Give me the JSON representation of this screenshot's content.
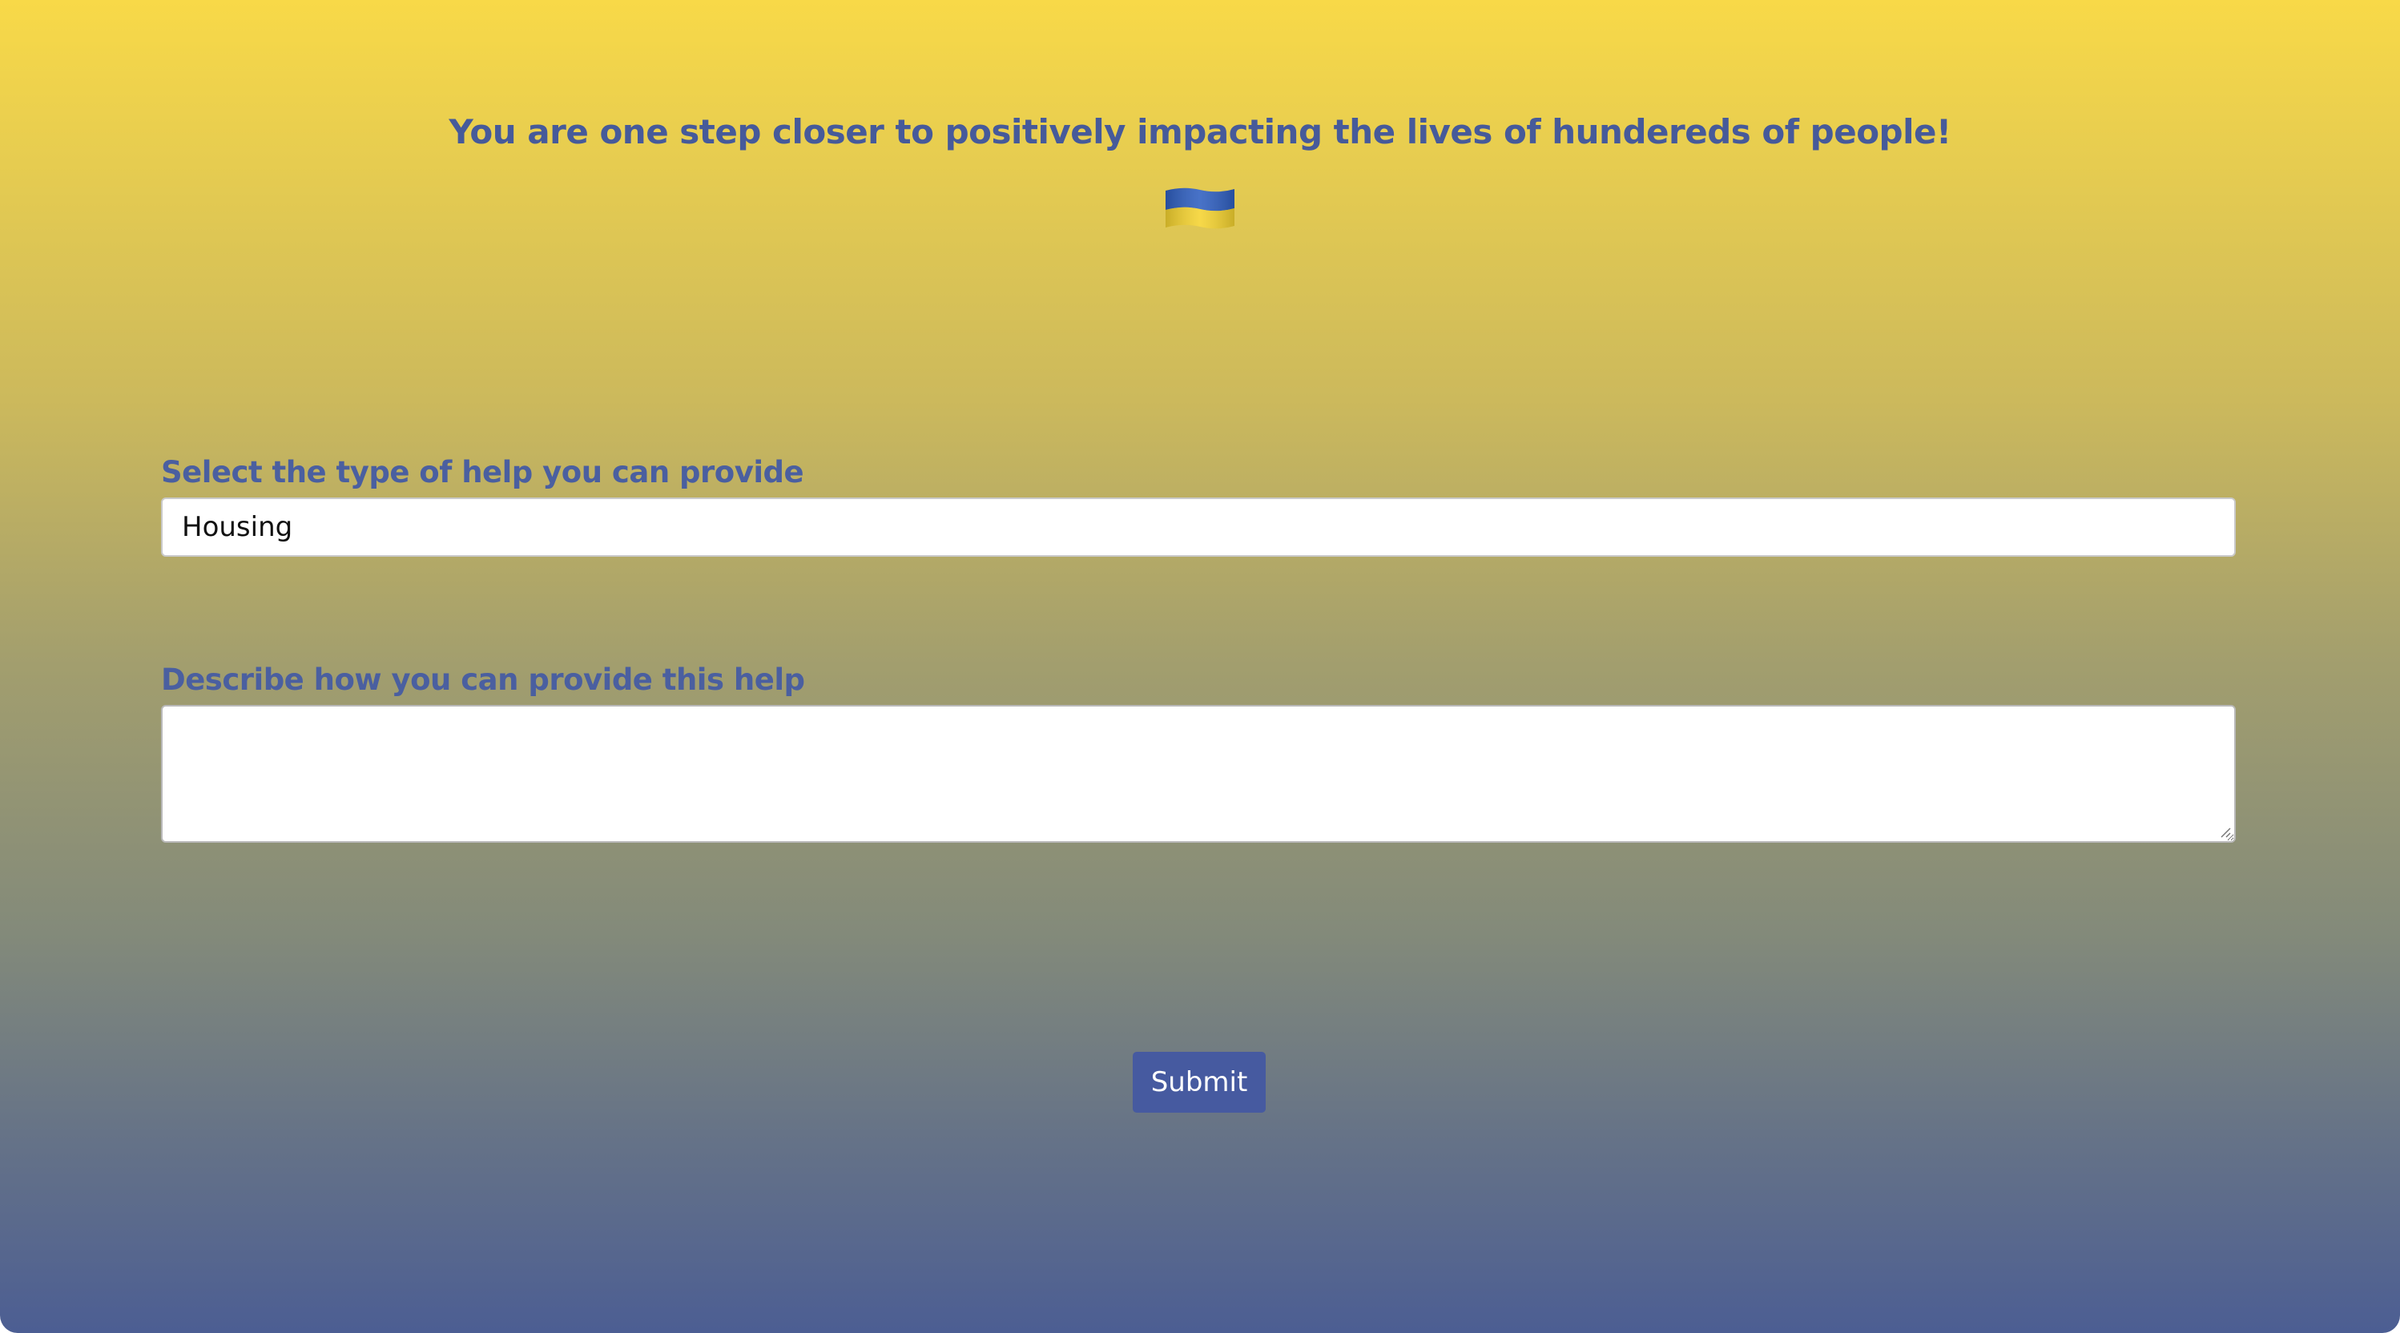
{
  "header": {
    "headline": "You are one step closer to positively impacting the lives of hundereds of people!",
    "flag_icon": "ukraine-flag-icon"
  },
  "form": {
    "help_type": {
      "label": "Select the type of help you can provide",
      "selected_value": "Housing"
    },
    "description": {
      "label": "Describe how you can provide this help",
      "value": ""
    },
    "submit_label": "Submit"
  },
  "colors": {
    "accent": "#465aa0",
    "gradient_top": "#f8d948",
    "gradient_bottom": "#4c5e93",
    "flag_blue": "#2f5fc0",
    "flag_yellow": "#f5d330"
  }
}
